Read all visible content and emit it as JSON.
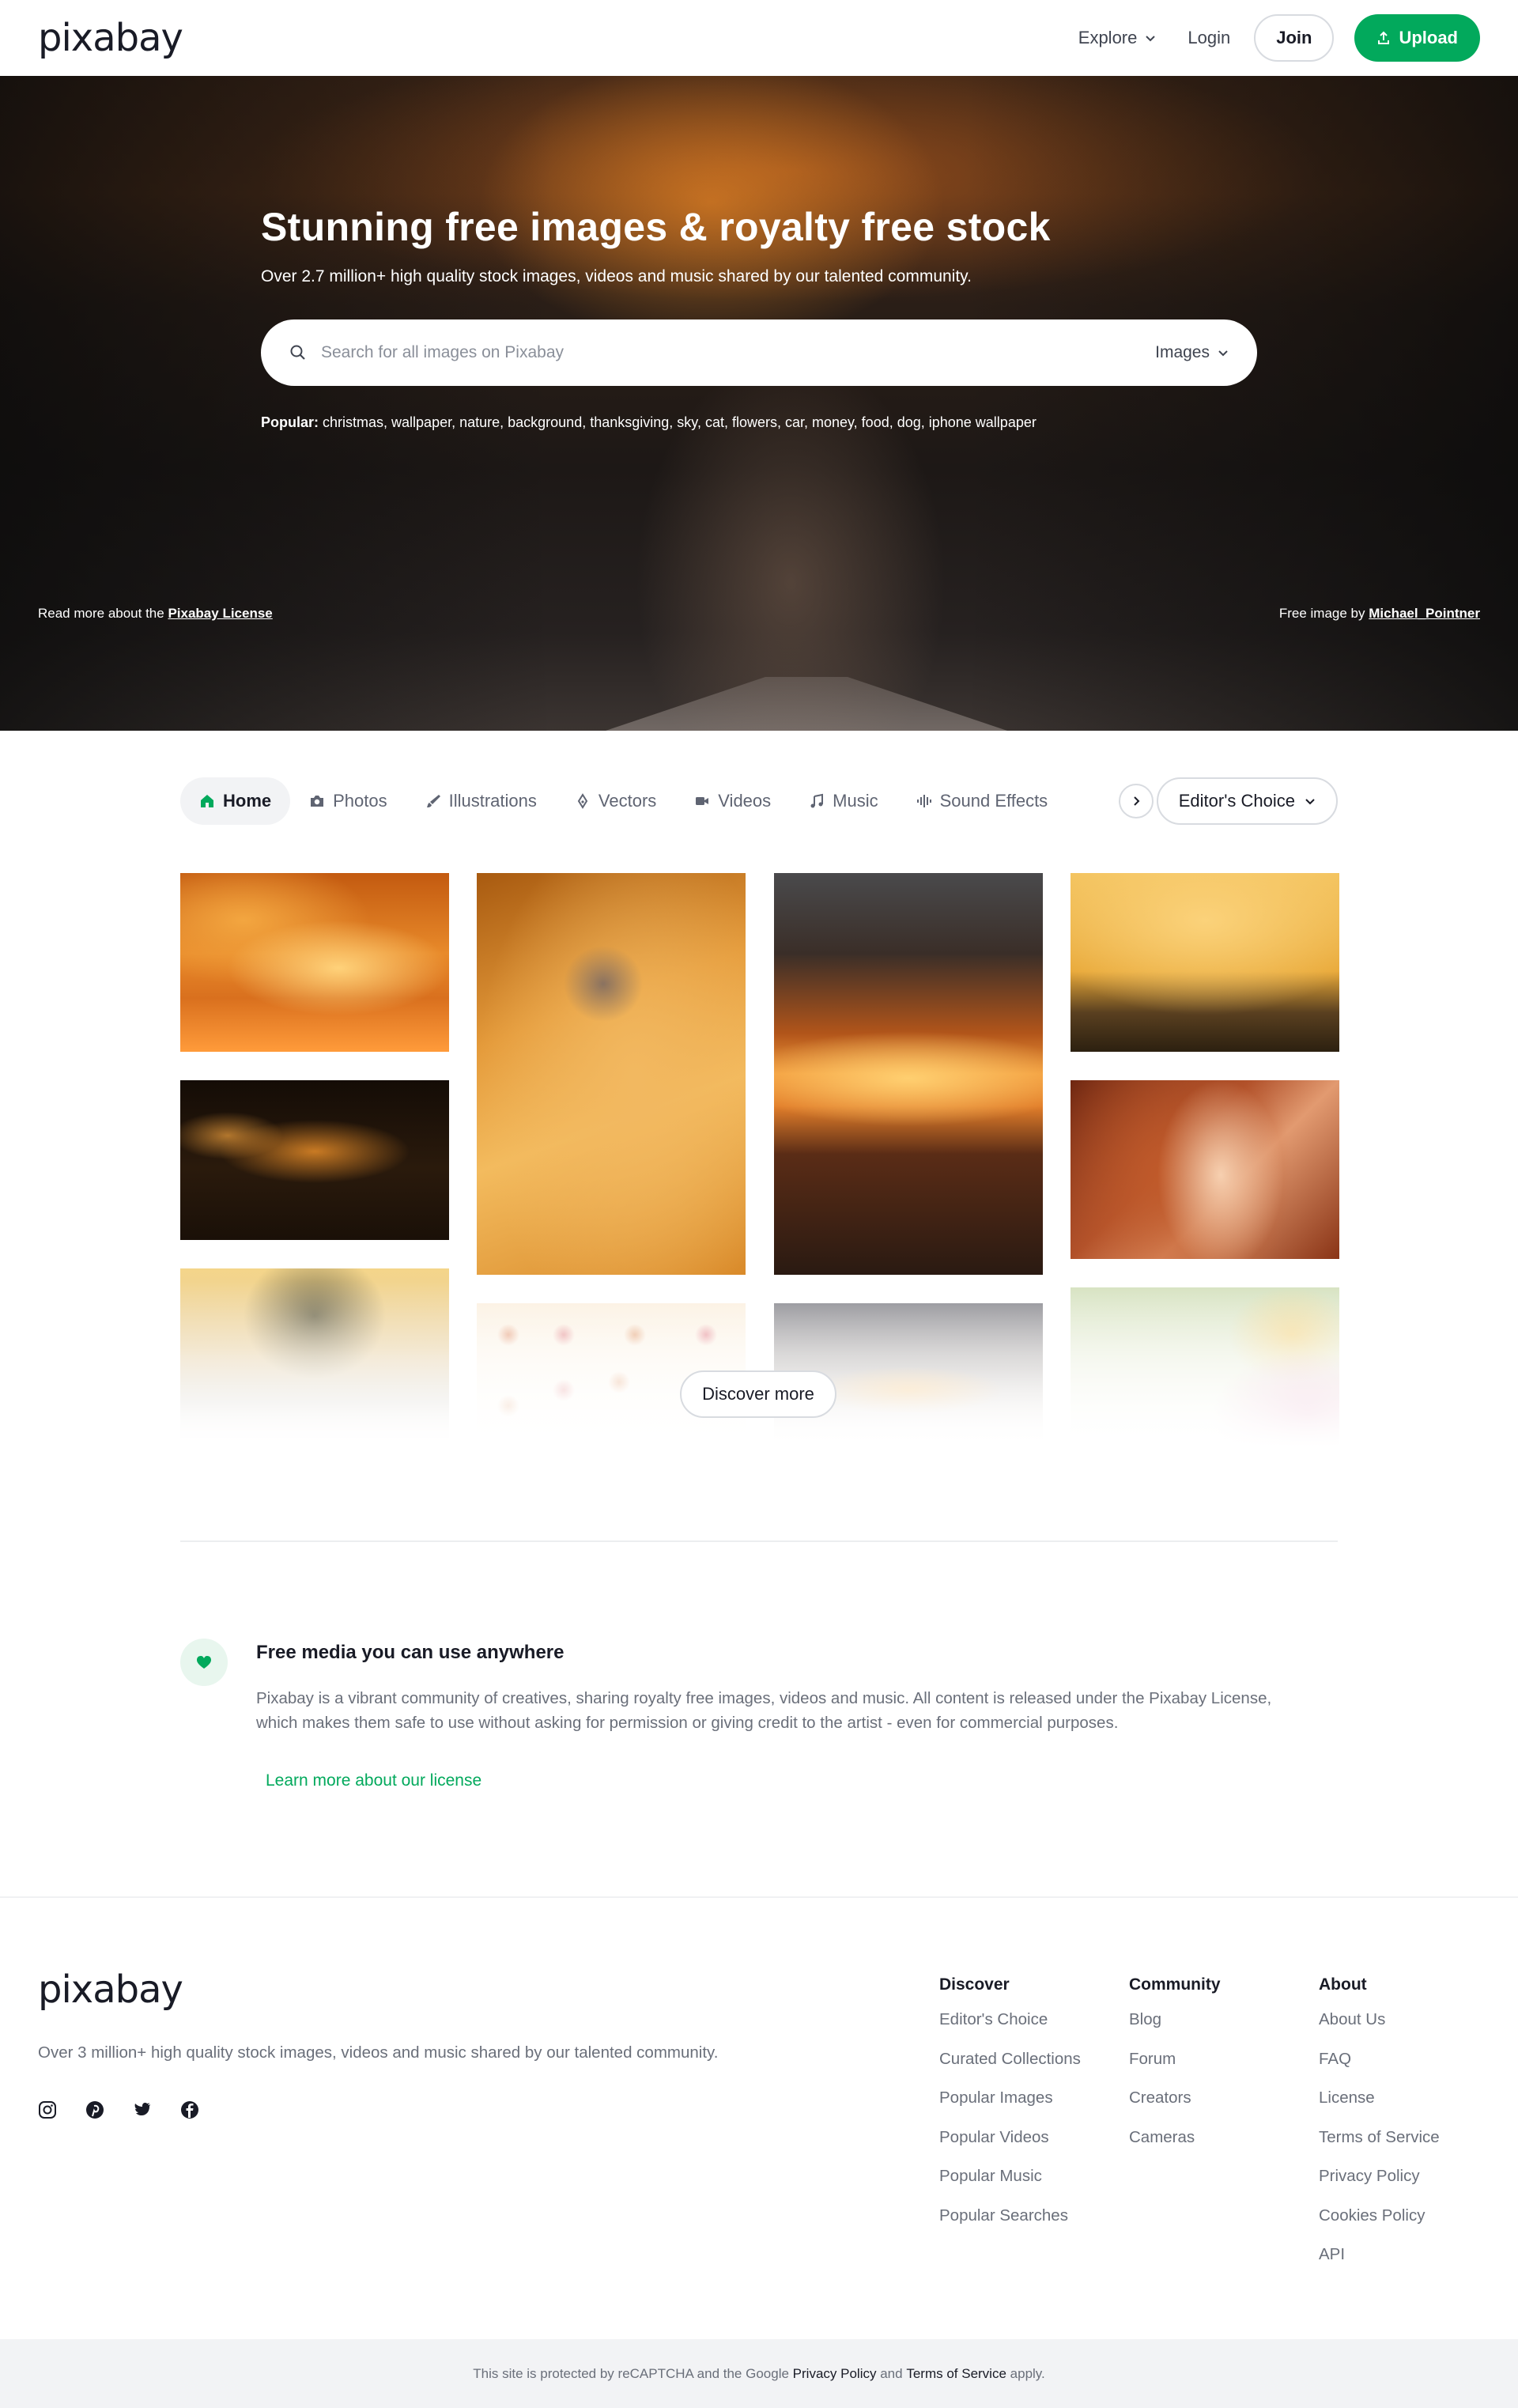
{
  "header": {
    "logo": "pixabay",
    "explore": "Explore",
    "login": "Login",
    "join": "Join",
    "upload": "Upload"
  },
  "hero": {
    "title": "Stunning free images & royalty free stock",
    "subtitle": "Over 2.7 million+ high quality stock images, videos and music shared by our talented community.",
    "search_placeholder": "Search for all images on Pixabay",
    "search_type": "Images",
    "popular_label": "Popular:",
    "popular_terms": "christmas, wallpaper, nature, background, thanksgiving, sky, cat, flowers, car, money, food, dog, iphone wallpaper",
    "license_prefix": "Read more about the",
    "license_link": "Pixabay License",
    "credit_prefix": "Free image by",
    "credit_author": "Michael_Pointner"
  },
  "tabs": {
    "items": [
      "Home",
      "Photos",
      "Illustrations",
      "Vectors",
      "Videos",
      "Music",
      "Sound Effects"
    ],
    "editors_choice": "Editor's Choice"
  },
  "gallery": {
    "discover_more": "Discover more"
  },
  "info": {
    "title": "Free media you can use anywhere",
    "text": "Pixabay is a vibrant community of creatives, sharing royalty free images, videos and music. All content is released under the Pixabay License, which makes them safe to use without asking for permission or giving credit to the artist - even for commercial purposes.",
    "link": "Learn more about our license"
  },
  "footer": {
    "logo": "pixabay",
    "text": "Over 3 million+ high quality stock images, videos and music shared by our talented community.",
    "social": [
      "instagram-icon",
      "pinterest-icon",
      "twitter-icon",
      "facebook-icon"
    ],
    "columns": [
      {
        "title": "Discover",
        "links": [
          "Editor's Choice",
          "Curated Collections",
          "Popular Images",
          "Popular Videos",
          "Popular Music",
          "Popular Searches"
        ]
      },
      {
        "title": "Community",
        "links": [
          "Blog",
          "Forum",
          "Creators",
          "Cameras"
        ]
      },
      {
        "title": "About",
        "links": [
          "About Us",
          "FAQ",
          "License",
          "Terms of Service",
          "Privacy Policy",
          "Cookies Policy",
          "API"
        ]
      }
    ],
    "recaptcha_prefix": "This site is protected by reCAPTCHA and the Google",
    "privacy": "Privacy Policy",
    "and": "and",
    "terms": "Terms of Service",
    "apply": "apply."
  },
  "colors": {
    "accent": "#02a95c",
    "text": "#191b26",
    "muted": "#6a6f7a"
  }
}
